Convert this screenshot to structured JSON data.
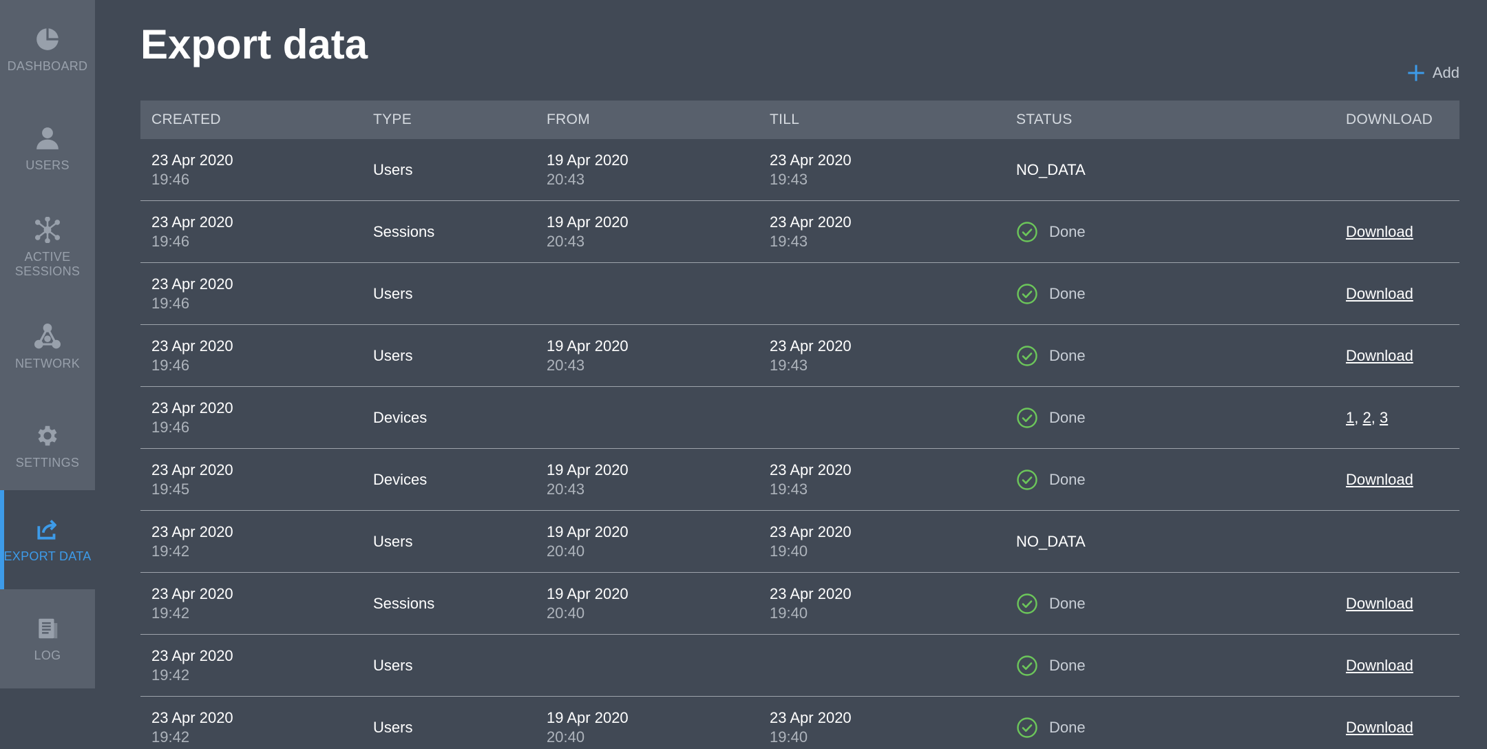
{
  "sidebar": {
    "items": [
      {
        "label": "DASHBOARD",
        "icon": "pie-chart-icon"
      },
      {
        "label": "USERS",
        "icon": "user-icon"
      },
      {
        "label": "ACTIVE\nSESSIONS",
        "icon": "sessions-graph-icon"
      },
      {
        "label": "NETWORK",
        "icon": "network-icon"
      },
      {
        "label": "SETTINGS",
        "icon": "gear-icon"
      },
      {
        "label": "EXPORT DATA",
        "icon": "export-icon",
        "active": true
      },
      {
        "label": "LOG",
        "icon": "log-document-icon"
      }
    ]
  },
  "page": {
    "title": "Export data",
    "add_label": "Add"
  },
  "table": {
    "columns": [
      "CREATED",
      "TYPE",
      "FROM",
      "TILL",
      "STATUS",
      "DOWNLOAD"
    ],
    "rows": [
      {
        "created_date": "23 Apr 2020",
        "created_time": "19:46",
        "type": "Users",
        "from_date": "19 Apr 2020",
        "from_time": "20:43",
        "till_date": "23 Apr 2020",
        "till_time": "19:43",
        "status": "NO_DATA",
        "download": ""
      },
      {
        "created_date": "23 Apr 2020",
        "created_time": "19:46",
        "type": "Sessions",
        "from_date": "19 Apr 2020",
        "from_time": "20:43",
        "till_date": "23 Apr 2020",
        "till_time": "19:43",
        "status": "Done",
        "download": "Download"
      },
      {
        "created_date": "23 Apr 2020",
        "created_time": "19:46",
        "type": "Users",
        "from_date": "",
        "from_time": "",
        "till_date": "",
        "till_time": "",
        "status": "Done",
        "download": "Download"
      },
      {
        "created_date": "23 Apr 2020",
        "created_time": "19:46",
        "type": "Users",
        "from_date": "19 Apr 2020",
        "from_time": "20:43",
        "till_date": "23 Apr 2020",
        "till_time": "19:43",
        "status": "Done",
        "download": "Download"
      },
      {
        "created_date": "23 Apr 2020",
        "created_time": "19:46",
        "type": "Devices",
        "from_date": "",
        "from_time": "",
        "till_date": "",
        "till_time": "",
        "status": "Done",
        "download_parts": [
          "1",
          "2",
          "3"
        ]
      },
      {
        "created_date": "23 Apr 2020",
        "created_time": "19:45",
        "type": "Devices",
        "from_date": "19 Apr 2020",
        "from_time": "20:43",
        "till_date": "23 Apr 2020",
        "till_time": "19:43",
        "status": "Done",
        "download": "Download"
      },
      {
        "created_date": "23 Apr 2020",
        "created_time": "19:42",
        "type": "Users",
        "from_date": "19 Apr 2020",
        "from_time": "20:40",
        "till_date": "23 Apr 2020",
        "till_time": "19:40",
        "status": "NO_DATA",
        "download": ""
      },
      {
        "created_date": "23 Apr 2020",
        "created_time": "19:42",
        "type": "Sessions",
        "from_date": "19 Apr 2020",
        "from_time": "20:40",
        "till_date": "23 Apr 2020",
        "till_time": "19:40",
        "status": "Done",
        "download": "Download"
      },
      {
        "created_date": "23 Apr 2020",
        "created_time": "19:42",
        "type": "Users",
        "from_date": "",
        "from_time": "",
        "till_date": "",
        "till_time": "",
        "status": "Done",
        "download": "Download"
      },
      {
        "created_date": "23 Apr 2020",
        "created_time": "19:42",
        "type": "Users",
        "from_date": "19 Apr 2020",
        "from_time": "20:40",
        "till_date": "23 Apr 2020",
        "till_time": "19:40",
        "status": "Done",
        "download": "Download"
      }
    ]
  },
  "colors": {
    "accent": "#3d9be9",
    "done": "#6cc65a",
    "background": "#414955",
    "sidebar_item": "#58606c",
    "header_row": "#58606c"
  }
}
